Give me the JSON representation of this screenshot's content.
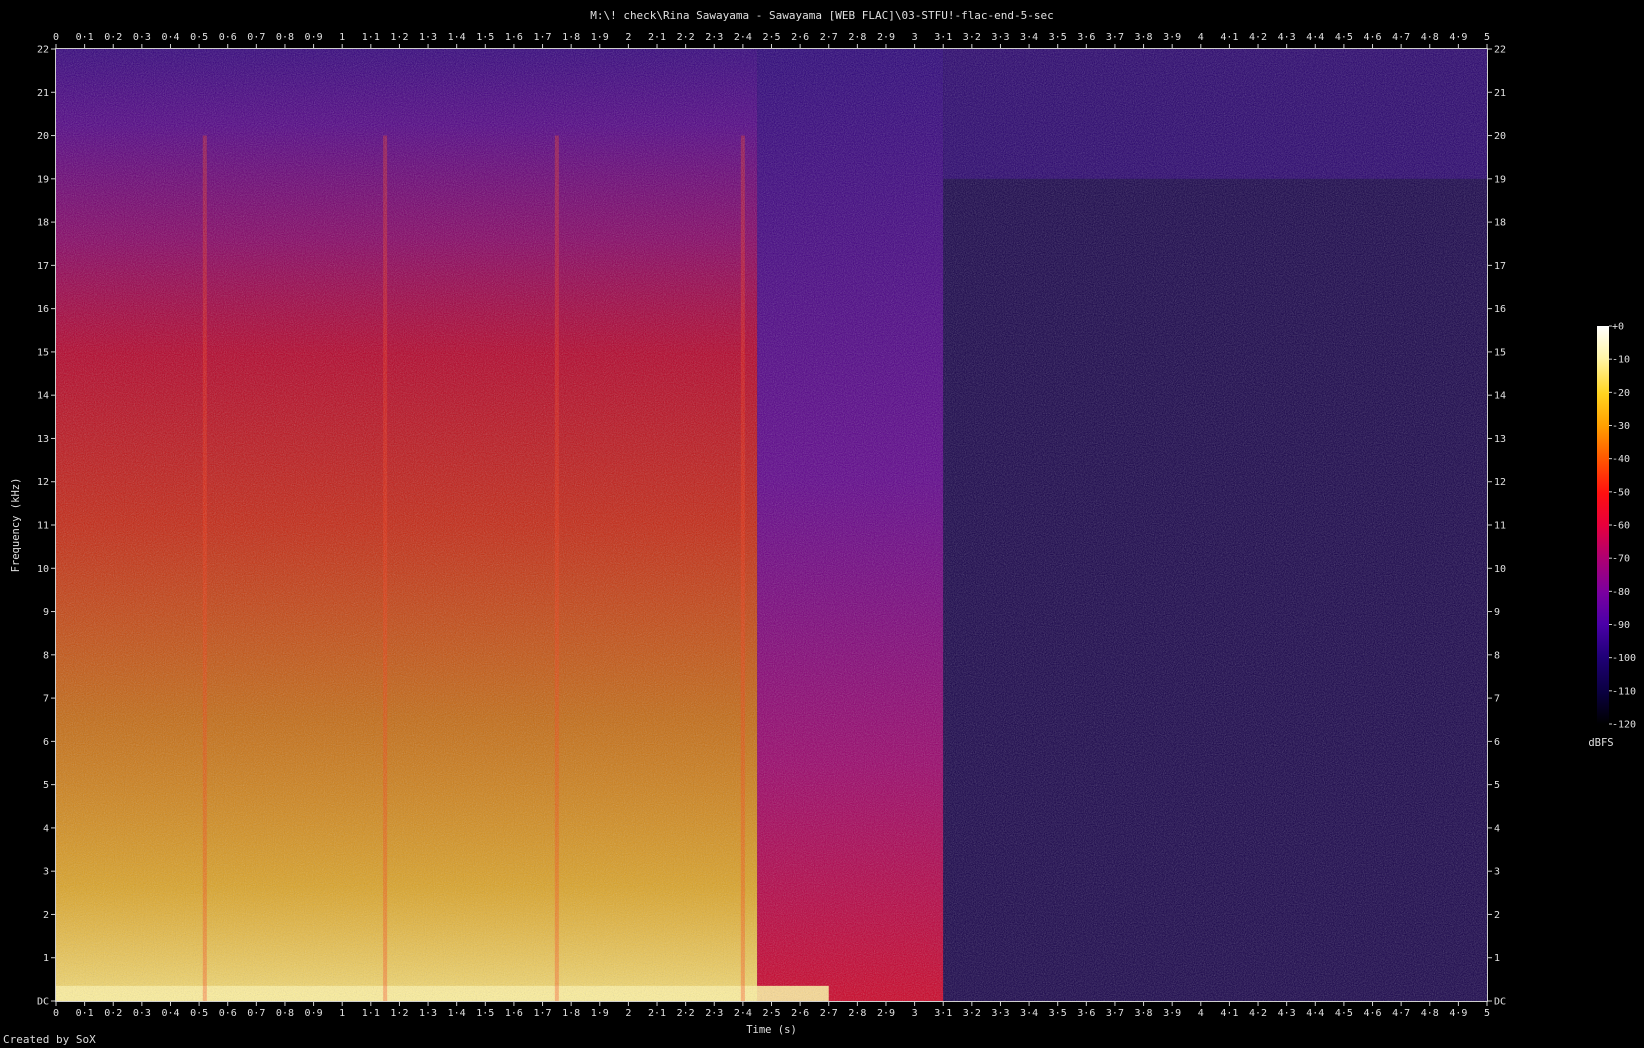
{
  "title": "M:\\! check\\Rina Sawayama - Sawayama [WEB FLAC]\\03-STFU!-flac-end-5-sec",
  "credit": "Created by SoX",
  "chart_data": {
    "type": "heatmap",
    "title": "M:\\! check\\Rina Sawayama - Sawayama [WEB FLAC]\\03-STFU!-flac-end-5-sec",
    "xlabel": "Time (s)",
    "ylabel": "Frequency (kHz)",
    "xlim": [
      0,
      5
    ],
    "ylim": [
      0,
      22
    ],
    "x_ticks": [
      "0",
      "0·1",
      "0·2",
      "0·3",
      "0·4",
      "0·5",
      "0·6",
      "0·7",
      "0·8",
      "0·9",
      "1",
      "1·1",
      "1·2",
      "1·3",
      "1·4",
      "1·5",
      "1·6",
      "1·7",
      "1·8",
      "1·9",
      "2",
      "2·1",
      "2·2",
      "2·3",
      "2·4",
      "2·5",
      "2·6",
      "2·7",
      "2·8",
      "2·9",
      "3",
      "3·1",
      "3·2",
      "3·3",
      "3·4",
      "3·5",
      "3·6",
      "3·7",
      "3·8",
      "3·9",
      "4",
      "4·1",
      "4·2",
      "4·3",
      "4·4",
      "4·5",
      "4·6",
      "4·7",
      "4·8",
      "4·9",
      "5"
    ],
    "y_ticks": [
      "DC",
      "1",
      "2",
      "3",
      "4",
      "5",
      "6",
      "7",
      "8",
      "9",
      "10",
      "11",
      "12",
      "13",
      "14",
      "15",
      "16",
      "17",
      "18",
      "19",
      "20",
      "21",
      "22"
    ],
    "colorbar": {
      "label": "dBFS",
      "range": [
        -120,
        0
      ],
      "ticks": [
        "+0",
        "-10",
        "-20",
        "-30",
        "-40",
        "-50",
        "-60",
        "-70",
        "-80",
        "-90",
        "-100",
        "-110",
        "-120"
      ],
      "colors": [
        "#ffffff",
        "#fff6a8",
        "#ffd420",
        "#ffa000",
        "#ff5a00",
        "#ff1010",
        "#e8003c",
        "#b00070",
        "#7a00a0",
        "#4a00a8",
        "#200078",
        "#0a0040",
        "#000000"
      ]
    },
    "regions": [
      {
        "t_start": 0.0,
        "t_end": 2.45,
        "description_level_db_low": -20,
        "description_level_db_high": -60
      },
      {
        "t_start": 2.45,
        "t_end": 3.1,
        "level_db": -75
      },
      {
        "t_start": 3.1,
        "t_end": 5.0,
        "level_db": -105
      }
    ],
    "grid": false
  }
}
